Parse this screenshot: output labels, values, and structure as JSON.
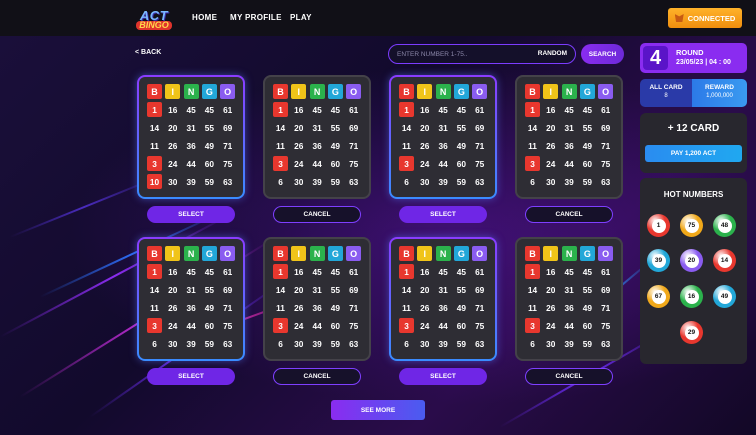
{
  "nav": {
    "logo_line1": "ACT",
    "logo_line2": "BINGO",
    "home": "HOME",
    "profile": "MY PROFILE",
    "play": "PLAY",
    "connected": "CONNECTED"
  },
  "controls": {
    "back": "< BACK",
    "search_placeholder": "ENTER NUMBER 1-75..",
    "random": "RANDOM",
    "search": "SEARCH",
    "see_more": "SEE MORE"
  },
  "header_letters": [
    "B",
    "I",
    "N",
    "G",
    "O"
  ],
  "header_colors": [
    "#e8372e",
    "#f0c419",
    "#2bb24c",
    "#22a7d8",
    "#8a5cf0"
  ],
  "cards": [
    {
      "state": "selected",
      "button": "SELECT",
      "rows": [
        [
          "1",
          "16",
          "45",
          "45",
          "61"
        ],
        [
          "14",
          "20",
          "31",
          "55",
          "69"
        ],
        [
          "11",
          "26",
          "36",
          "49",
          "71"
        ],
        [
          "3",
          "24",
          "44",
          "60",
          "75"
        ],
        [
          "10",
          "30",
          "39",
          "59",
          "63"
        ]
      ],
      "marked": [
        [
          0,
          0
        ],
        [
          3,
          0
        ],
        [
          4,
          0
        ]
      ]
    },
    {
      "state": "default",
      "button": "CANCEL",
      "rows": [
        [
          "1",
          "16",
          "45",
          "45",
          "61"
        ],
        [
          "14",
          "20",
          "31",
          "55",
          "69"
        ],
        [
          "11",
          "26",
          "36",
          "49",
          "71"
        ],
        [
          "3",
          "24",
          "44",
          "60",
          "75"
        ],
        [
          "6",
          "30",
          "39",
          "59",
          "63"
        ]
      ],
      "marked": [
        [
          0,
          0
        ],
        [
          3,
          0
        ]
      ]
    },
    {
      "state": "selected",
      "button": "SELECT",
      "rows": [
        [
          "1",
          "16",
          "45",
          "45",
          "61"
        ],
        [
          "14",
          "20",
          "31",
          "55",
          "69"
        ],
        [
          "11",
          "26",
          "36",
          "49",
          "71"
        ],
        [
          "3",
          "24",
          "44",
          "60",
          "75"
        ],
        [
          "6",
          "30",
          "39",
          "59",
          "63"
        ]
      ],
      "marked": [
        [
          0,
          0
        ],
        [
          3,
          0
        ]
      ]
    },
    {
      "state": "default",
      "button": "CANCEL",
      "rows": [
        [
          "1",
          "16",
          "45",
          "45",
          "61"
        ],
        [
          "14",
          "20",
          "31",
          "55",
          "69"
        ],
        [
          "11",
          "26",
          "36",
          "49",
          "71"
        ],
        [
          "3",
          "24",
          "44",
          "60",
          "75"
        ],
        [
          "6",
          "30",
          "39",
          "59",
          "63"
        ]
      ],
      "marked": [
        [
          0,
          0
        ],
        [
          3,
          0
        ]
      ]
    },
    {
      "state": "selected",
      "button": "SELECT",
      "rows": [
        [
          "1",
          "16",
          "45",
          "45",
          "61"
        ],
        [
          "14",
          "20",
          "31",
          "55",
          "69"
        ],
        [
          "11",
          "26",
          "36",
          "49",
          "71"
        ],
        [
          "3",
          "24",
          "44",
          "60",
          "75"
        ],
        [
          "6",
          "30",
          "39",
          "59",
          "63"
        ]
      ],
      "marked": [
        [
          0,
          0
        ],
        [
          3,
          0
        ]
      ]
    },
    {
      "state": "default",
      "button": "CANCEL",
      "rows": [
        [
          "1",
          "16",
          "45",
          "45",
          "61"
        ],
        [
          "14",
          "20",
          "31",
          "55",
          "69"
        ],
        [
          "11",
          "26",
          "36",
          "49",
          "71"
        ],
        [
          "3",
          "24",
          "44",
          "60",
          "75"
        ],
        [
          "6",
          "30",
          "39",
          "59",
          "63"
        ]
      ],
      "marked": [
        [
          0,
          0
        ],
        [
          3,
          0
        ]
      ]
    },
    {
      "state": "selected",
      "button": "SELECT",
      "rows": [
        [
          "1",
          "16",
          "45",
          "45",
          "61"
        ],
        [
          "14",
          "20",
          "31",
          "55",
          "69"
        ],
        [
          "11",
          "26",
          "36",
          "49",
          "71"
        ],
        [
          "3",
          "24",
          "44",
          "60",
          "75"
        ],
        [
          "6",
          "30",
          "39",
          "59",
          "63"
        ]
      ],
      "marked": [
        [
          0,
          0
        ],
        [
          3,
          0
        ]
      ]
    },
    {
      "state": "default",
      "button": "CANCEL",
      "rows": [
        [
          "1",
          "16",
          "45",
          "45",
          "61"
        ],
        [
          "14",
          "20",
          "31",
          "55",
          "69"
        ],
        [
          "11",
          "26",
          "36",
          "49",
          "71"
        ],
        [
          "3",
          "24",
          "44",
          "60",
          "75"
        ],
        [
          "6",
          "30",
          "39",
          "59",
          "63"
        ]
      ],
      "marked": [
        [
          0,
          0
        ],
        [
          3,
          0
        ]
      ]
    }
  ],
  "round": {
    "number": "4",
    "label": "ROUND",
    "datetime": "23/05/23 | 04 : 00"
  },
  "stats": {
    "all_card_label": "ALL CARD",
    "all_card_value": "8",
    "reward_label": "REWARD",
    "reward_value": "1,000,000"
  },
  "purchase": {
    "title": "+ 12 CARD",
    "button": "PAY 1,200 ACT"
  },
  "hot_numbers": {
    "title": "HOT NUMBERS",
    "balls": [
      {
        "n": "1",
        "color": "#e8372e"
      },
      {
        "n": "75",
        "color": "#f0a81a"
      },
      {
        "n": "48",
        "color": "#2bb24c"
      },
      {
        "n": "39",
        "color": "#22a7d8"
      },
      {
        "n": "20",
        "color": "#8a5cf0"
      },
      {
        "n": "14",
        "color": "#e8372e"
      },
      {
        "n": "67",
        "color": "#f0a81a"
      },
      {
        "n": "16",
        "color": "#2bb24c"
      },
      {
        "n": "49",
        "color": "#22a7d8"
      },
      {
        "n": "29",
        "color": "#e8372e"
      }
    ]
  }
}
